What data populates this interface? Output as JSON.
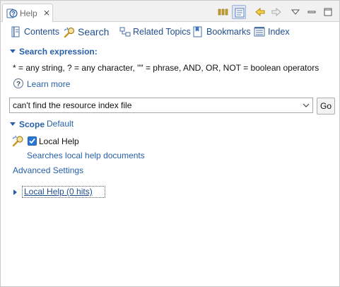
{
  "view": {
    "title": "Help",
    "close_glyph": "⨯"
  },
  "toolbar": {
    "buttons": [
      {
        "name": "show-all-topics-icon",
        "pressed": false
      },
      {
        "name": "show-in-toc-icon",
        "pressed": true
      },
      {
        "name": "back-icon",
        "pressed": false
      },
      {
        "name": "forward-icon",
        "pressed": false
      },
      {
        "name": "view-menu-icon",
        "pressed": false
      },
      {
        "name": "minimize-icon",
        "pressed": false
      },
      {
        "name": "maximize-icon",
        "pressed": false
      }
    ]
  },
  "nav": {
    "contents": "Contents",
    "search": "Search",
    "related": "Related Topics",
    "bookmarks": "Bookmarks",
    "index": "Index",
    "active": "search"
  },
  "search_section": {
    "heading": "Search expression:",
    "hint": "* = any string, ? = any character, \"\" = phrase, AND, OR, NOT = boolean operators",
    "learn_more": "Learn more",
    "query": "can't find the resource index file",
    "go_label": "Go"
  },
  "scope": {
    "heading": "Scope",
    "link": "Default",
    "local_help_label": "Local Help",
    "local_help_checked": true,
    "description": "Searches local help documents",
    "advanced": "Advanced Settings"
  },
  "results": {
    "label": "Local Help (0 hits)"
  },
  "colors": {
    "link": "#2760a7",
    "checkbox": "#2a78d6"
  }
}
